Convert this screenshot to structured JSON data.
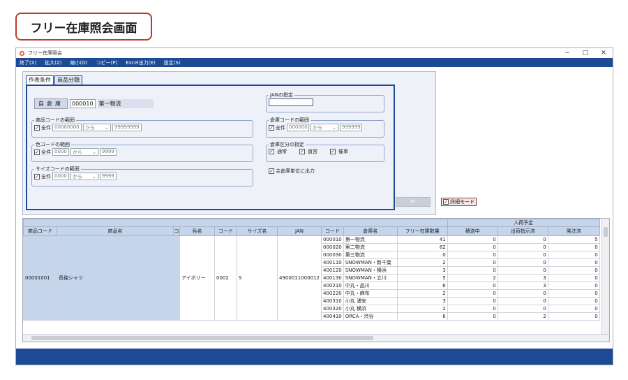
{
  "page_title": "フリー在庫照会画面",
  "window": {
    "title": "フリー在庫照会",
    "controls": [
      "−",
      "□",
      "✕"
    ]
  },
  "menu": [
    "終了(X)",
    "拡大(Z)",
    "縮小(O)",
    "コピー(P)",
    "Excel出力(E)",
    "設定(S)"
  ],
  "tabs": [
    "作表条件",
    "商品分類"
  ],
  "warehouse": {
    "label": "自倉庫",
    "code": "000010",
    "name": "第一物流"
  },
  "product_range": {
    "legend": "商品コードの範囲",
    "all_label": "全件",
    "from": "00000000",
    "mode": "から",
    "to": "99999999"
  },
  "color_range": {
    "legend": "色コードの範囲",
    "all_label": "全件",
    "from": "0000",
    "mode": "から",
    "to": "9999"
  },
  "size_range": {
    "legend": "サイズコードの範囲",
    "all_label": "全件",
    "from": "0000",
    "mode": "から",
    "to": "9999"
  },
  "jan": {
    "legend": "JANの指定",
    "value": ""
  },
  "warehouse_range": {
    "legend": "倉庫コードの範囲",
    "all_label": "全件",
    "from": "000000",
    "mode": "から",
    "to": "999999"
  },
  "warehouse_type": {
    "legend": "倉庫区分の指定",
    "options": [
      "通常",
      "直営",
      "催事"
    ]
  },
  "main_wh_output": "主倉庫単位に出力",
  "enter_button": "↵",
  "detail_mode": "詳細モード",
  "grid": {
    "group_header": "入荷予定",
    "columns": [
      "商品コード",
      "商品名",
      "コ",
      "色名",
      "コード",
      "サイズ名",
      "JAN",
      "コード",
      "倉庫名",
      "フリー在庫数量",
      "積送中",
      "出荷指示済",
      "発注済"
    ],
    "product": {
      "code": "00001001",
      "name": "長袖シャツ",
      "color": "アイボリー",
      "size_code": "0002",
      "size": "S",
      "jan": "4900011000012"
    },
    "rows": [
      {
        "code": "000010",
        "name": "第一物流",
        "free": "41",
        "transit": "0",
        "ship": "0",
        "order": "5"
      },
      {
        "code": "000020",
        "name": "第二物流",
        "free": "82",
        "transit": "0",
        "ship": "0",
        "order": "0"
      },
      {
        "code": "000030",
        "name": "第三物流",
        "free": "0",
        "transit": "0",
        "ship": "0",
        "order": "0"
      },
      {
        "code": "400110",
        "name": "SNOWMAN・新千葉",
        "free": "2",
        "transit": "0",
        "ship": "0",
        "order": "0"
      },
      {
        "code": "400120",
        "name": "SNOWMAN・横浜",
        "free": "3",
        "transit": "0",
        "ship": "0",
        "order": "0"
      },
      {
        "code": "400130",
        "name": "SNOWMAN・立川",
        "free": "5",
        "transit": "2",
        "ship": "3",
        "order": "0"
      },
      {
        "code": "400210",
        "name": "中丸・品川",
        "free": "6",
        "transit": "0",
        "ship": "3",
        "order": "0"
      },
      {
        "code": "400220",
        "name": "中丸・麻布",
        "free": "2",
        "transit": "0",
        "ship": "0",
        "order": "0"
      },
      {
        "code": "400310",
        "name": "小丸 浦安",
        "free": "3",
        "transit": "0",
        "ship": "0",
        "order": "0"
      },
      {
        "code": "400320",
        "name": "小丸 横浜",
        "free": "2",
        "transit": "0",
        "ship": "0",
        "order": "0"
      },
      {
        "code": "400410",
        "name": "ORCA・渋谷",
        "free": "6",
        "transit": "0",
        "ship": "2",
        "order": "0"
      }
    ]
  }
}
